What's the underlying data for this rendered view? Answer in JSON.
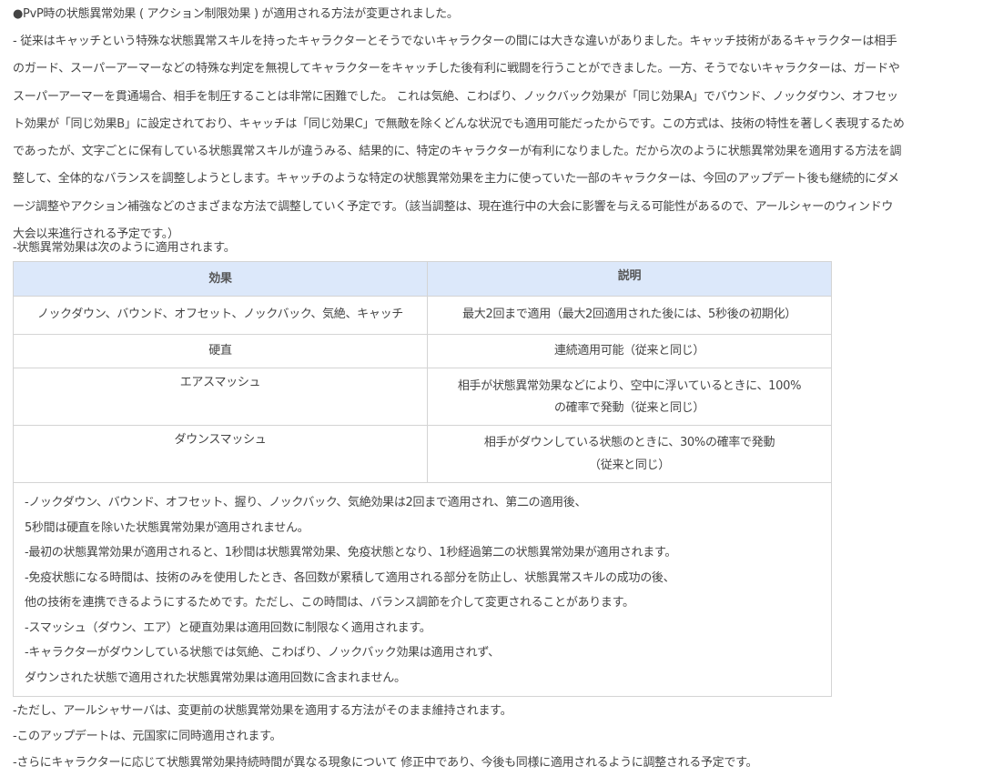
{
  "heading": "●PvP時の状態異常効果 ( アクション制限効果 ) が適用される方法が変更されました。",
  "paragraph": [
    "- 従来はキャッチという特殊な状態異常スキルを持ったキャラクターとそうでないキャラクターの間には大きな違いがありました。キャッチ技術があるキャラクターは相手",
    "のガード、スーパーアーマーなどの特殊な判定を無視してキャラクターをキャッチした後有利に戦闘を行うことができました。一方、そうでないキャラクターは、ガードや",
    "スーパーアーマーを貫通場合、相手を制圧することは非常に困難でした。 これは気絶、こわばり、ノックバック効果が「同じ効果A」でバウンド、ノックダウン、オフセッ",
    "ト効果が「同じ効果B」に設定されており、キャッチは「同じ効果C」で無敵を除くどんな状況でも適用可能だったからです。この方式は、技術の特性を著しく表現するため",
    "であったが、文字ごとに保有している状態異常スキルが違うみる、結果的に、特定のキャラクターが有利になりました。だから次のように状態異常効果を適用する方法を調",
    "整して、全体的なバランスを調整しようとします。キャッチのような特定の状態異常効果を主力に使っていた一部のキャラクターは、今回のアップデート後も継続的にダメ",
    "ージ調整やアクション補強などのさまざまな方法で調整していく予定です。（該当調整は、現在進行中の大会に影響を与える可能性があるので、アールシャーのウィンドウ",
    "大会以来進行される予定です。）"
  ],
  "table_intro": "-状態異常効果は次のように適用されます。",
  "table": {
    "headers": [
      "効果",
      "説明"
    ],
    "rows": [
      {
        "effect": "ノックダウン、バウンド、オフセット、ノックバック、気絶、キャッチ",
        "desc": [
          "最大2回まで適用（最大2回適用された後には、5秒後の初期化）"
        ]
      },
      {
        "effect": "硬直",
        "desc": [
          "連続適用可能（従来と同じ）"
        ]
      },
      {
        "effect": "エアスマッシュ",
        "desc": [
          "相手が状態異常効果などにより、空中に浮いているときに、100%",
          "の確率で発動（従来と同じ）"
        ]
      },
      {
        "effect": "ダウンスマッシュ",
        "desc": [
          "相手がダウンしている状態のときに、30%の確率で発動",
          "（従来と同じ）"
        ]
      }
    ],
    "notes": [
      "-ノックダウン、バウンド、オフセット、握り、ノックバック、気絶効果は2回まで適用され、第二の適用後、",
      "5秒間は硬直を除いた状態異常効果が適用されません。",
      "-最初の状態異常効果が適用されると、1秒間は状態異常効果、免疫状態となり、1秒経過第二の状態異常効果が適用されます。",
      "-免疫状態になる時間は、技術のみを使用したとき、各回数が累積して適用される部分を防止し、状態異常スキルの成功の後、",
      "他の技術を連携できるようにするためです。ただし、この時間は、バランス調節を介して変更されることがあります。",
      "-スマッシュ（ダウン、エア）と硬直効果は適用回数に制限なく適用されます。",
      "-キャラクターがダウンしている状態では気絶、こわばり、ノックバック効果は適用されず、",
      "ダウンされた状態で適用された状態異常効果は適用回数に含まれません。"
    ]
  },
  "footer": [
    "-ただし、アールシャサーバは、変更前の状態異常効果を適用する方法がそのまま維持されます。",
    "-このアップデートは、元国家に同時適用されます。",
    "-さらにキャラクターに応じて状態異常効果持続時間が異なる現象について 修正中であり、今後も同様に適用されるように調整される予定です。"
  ]
}
